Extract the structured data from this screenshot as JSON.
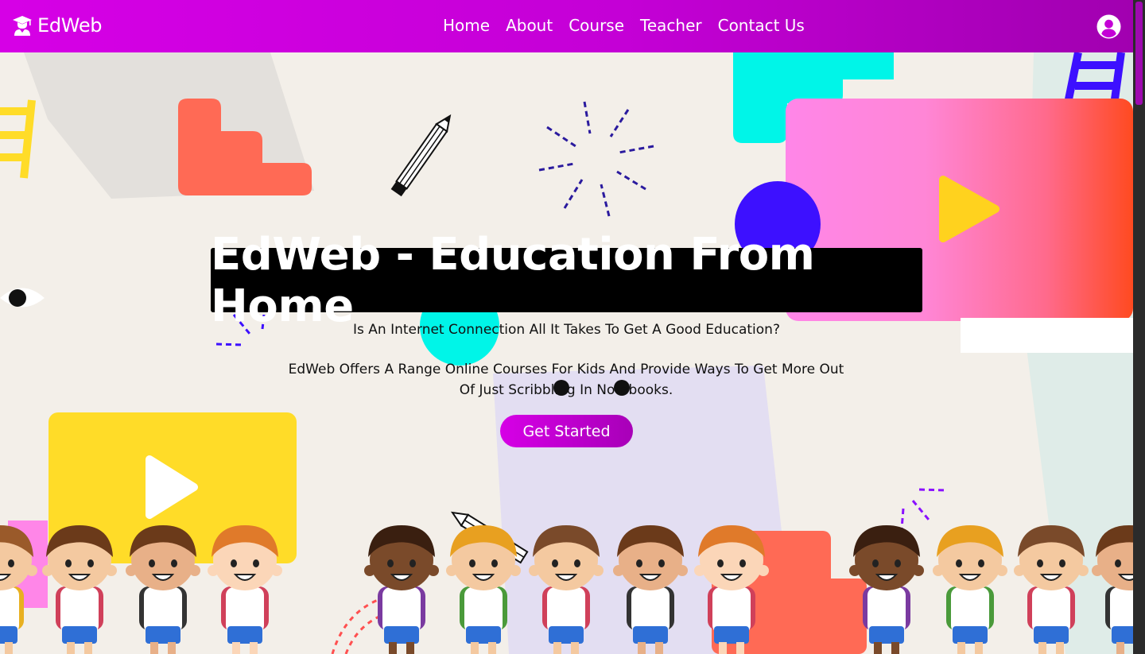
{
  "header": {
    "brand": "EdWeb",
    "nav": [
      "Home",
      "About",
      "Course",
      "Teacher",
      "Contact Us"
    ]
  },
  "hero": {
    "title": "EdWeb - Education From Home",
    "subtitle": "Is An Internet Connection All It Takes To Get A Good Education?",
    "description": "EdWeb Offers A Range Online Courses For Kids And Provide Ways To Get More Out Of Just Scribbling In Notebooks.",
    "cta_label": "Get Started"
  },
  "colors": {
    "header_gradient_start": "#d600e6",
    "header_gradient_end": "#a100b0",
    "page_background": "#f3efe9",
    "title_background": "#000000",
    "accent_coral": "#ff6a55",
    "accent_cyan": "#00f5e8",
    "accent_yellow": "#ffdc28",
    "accent_blue": "#3d10ff",
    "accent_pink": "#ff86e8"
  },
  "icons": {
    "logo": "graduate-icon",
    "account": "user-circle-icon"
  }
}
